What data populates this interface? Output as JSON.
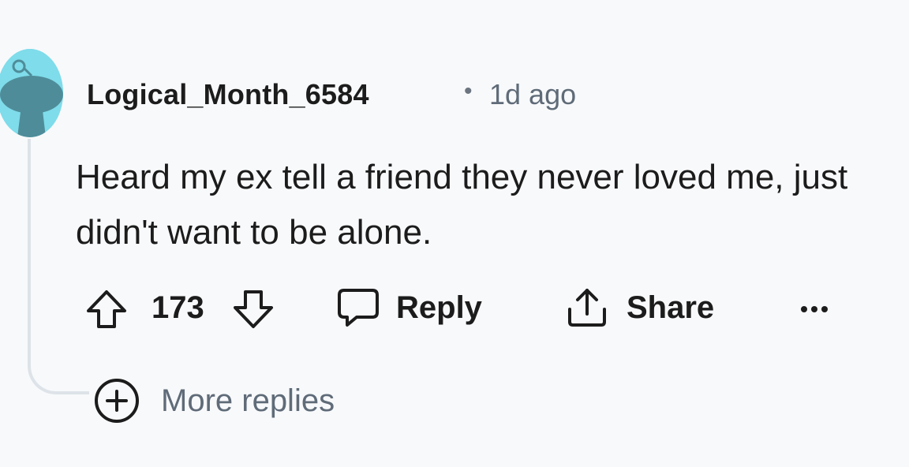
{
  "comment": {
    "author": "Logical_Month_6584",
    "separator": "•",
    "timestamp": "1d ago",
    "body": "Heard my ex tell a friend they never loved me, just didn't want to be alone.",
    "avatar_icon": "reddit-snoo-avatar-icon",
    "avatar_color": "#7fdcea"
  },
  "actions": {
    "vote_count": "173",
    "reply_label": "Reply",
    "share_label": "Share",
    "upvote_icon": "arrow-up-icon",
    "downvote_icon": "arrow-down-icon",
    "reply_icon": "speech-bubble-icon",
    "share_icon": "share-upload-icon",
    "more_icon": "ellipsis-icon"
  },
  "more_replies": {
    "label": "More replies",
    "icon": "plus-circle-icon"
  },
  "colors": {
    "background": "#f8f9fb",
    "thread_line": "#dde3e8",
    "meta_text": "#5f6b78"
  }
}
